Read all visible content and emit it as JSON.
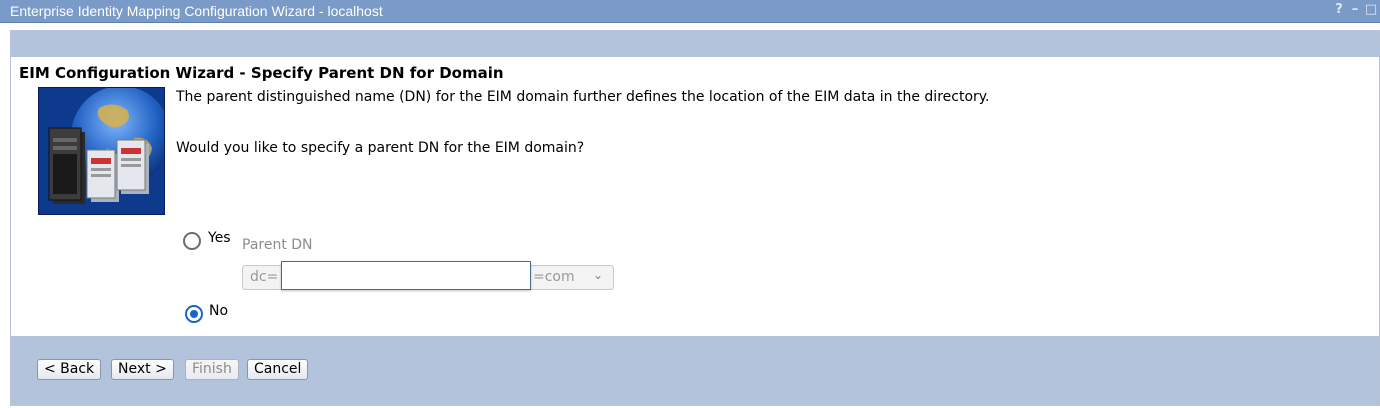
{
  "window": {
    "title": "Enterprise Identity Mapping Configuration Wizard - localhost",
    "controls": [
      "?",
      "–",
      "□"
    ]
  },
  "page": {
    "heading": "EIM Configuration Wizard - Specify Parent DN for Domain",
    "description": "The parent distinguished name (DN) for the EIM domain further defines the location of the EIM data in the directory.",
    "question": "Would you like to specify a parent DN for the EIM domain?"
  },
  "options": {
    "yes_label": "Yes",
    "no_label": "No",
    "selected": "No"
  },
  "parent_dn": {
    "label": "Parent DN",
    "prefix_text": "dc=",
    "suffix_text": "=com",
    "input_value": ""
  },
  "buttons": {
    "back": "< Back",
    "next": "Next >",
    "finish": "Finish",
    "cancel": "Cancel"
  },
  "icons": {
    "radio_selected_color": "#1765c8",
    "illustration": "servers-and-globe-illustration",
    "dropdown": "chevron-down-icon"
  },
  "colors": {
    "titlebar": "#7a9ac8",
    "band": "#b3c3dc"
  }
}
